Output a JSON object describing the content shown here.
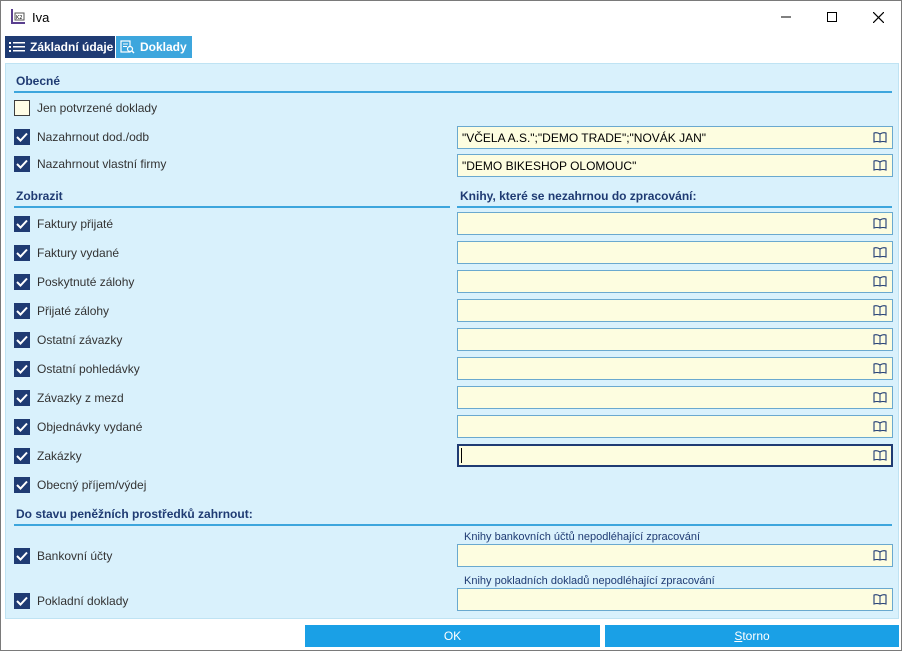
{
  "window": {
    "title": "Iva"
  },
  "tabs": [
    {
      "label": "Základní údaje",
      "active": false
    },
    {
      "label": "Doklady",
      "active": true
    }
  ],
  "general": {
    "title": "Obecné",
    "only_confirmed": {
      "label": "Jen potvrzené doklady",
      "checked": false
    },
    "exclude_suppliers": {
      "label": "Nazahrnout dod./odb",
      "checked": true,
      "value": "\"VČELA A.S.\";\"DEMO TRADE\";\"NOVÁK JAN\""
    },
    "exclude_own_firms": {
      "label": "Nazahrnout vlastní firmy",
      "checked": true,
      "value": "\"DEMO BIKESHOP OLOMOUC\""
    }
  },
  "display": {
    "title": "Zobrazit",
    "books_title": "Knihy, které se nezahrnou do zpracování:",
    "items": [
      {
        "label": "Faktury přijaté",
        "checked": true,
        "value": ""
      },
      {
        "label": "Faktury vydané",
        "checked": true,
        "value": ""
      },
      {
        "label": "Poskytnuté zálohy",
        "checked": true,
        "value": ""
      },
      {
        "label": "Přijaté zálohy",
        "checked": true,
        "value": ""
      },
      {
        "label": "Ostatní závazky",
        "checked": true,
        "value": ""
      },
      {
        "label": "Ostatní pohledávky",
        "checked": true,
        "value": ""
      },
      {
        "label": "Závazky z mezd",
        "checked": true,
        "value": ""
      },
      {
        "label": "Objednávky vydané",
        "checked": true,
        "value": ""
      },
      {
        "label": "Zakázky",
        "checked": true,
        "value": ""
      },
      {
        "label": "Obecný příjem/výdej",
        "checked": true
      }
    ]
  },
  "cash": {
    "title": "Do stavu peněžních prostředků zahrnout:",
    "bank": {
      "label": "Bankovní účty",
      "checked": true,
      "field_label": "Knihy bankovních účtů nepodléhající zpracování",
      "value": ""
    },
    "cashdesk": {
      "label": "Pokladní doklady",
      "checked": true,
      "field_label": "Knihy pokladních dokladů nepodléhající zpracování",
      "value": ""
    }
  },
  "buttons": {
    "ok": "OK",
    "cancel_first": "S",
    "cancel_rest": "torno"
  },
  "colors": {
    "accent": "#1aa0e6",
    "navy": "#1f3b73",
    "panel": "#d9f1fc",
    "field": "#fdfde0"
  }
}
